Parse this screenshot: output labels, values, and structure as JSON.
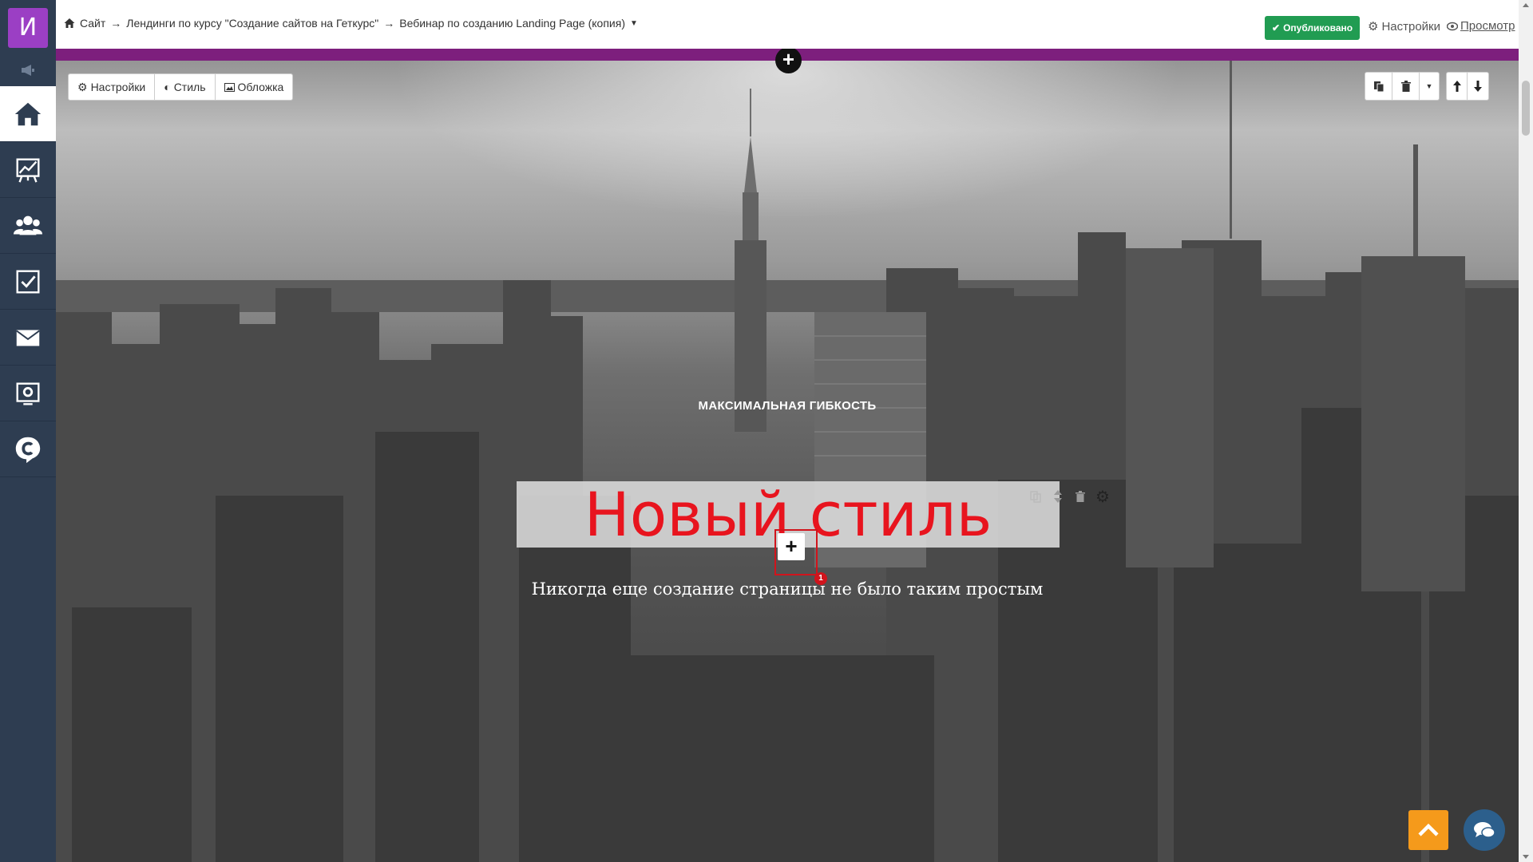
{
  "sidebar": {
    "logo_letter": "И",
    "items": [
      {
        "icon": "home-icon",
        "active": true
      },
      {
        "icon": "chart-board-icon",
        "active": false
      },
      {
        "icon": "users-icon",
        "active": false
      },
      {
        "icon": "checkbox-icon",
        "active": false
      },
      {
        "icon": "envelope-icon",
        "active": false
      },
      {
        "icon": "cog-monitor-icon",
        "active": false
      },
      {
        "icon": "chat-c-icon",
        "active": false
      }
    ]
  },
  "breadcrumb": {
    "site": "Сайт",
    "section": "Лендинги по курсу \"Создание сайтов на Геткурс\"",
    "page": "Вебинар по созданию Landing Page (копия)",
    "separator": "→"
  },
  "header": {
    "published_label": "Опубликовано",
    "settings_label": "Настройки",
    "preview_label": "Просмотр"
  },
  "block_toolbar": {
    "settings_label": "Настройки",
    "style_label": "Стиль",
    "cover_label": "Обложка"
  },
  "hero": {
    "eyebrow": "МАКСИМАЛЬНАЯ ГИБКОСТЬ",
    "title": "Новый стиль",
    "subtitle": "Никогда еще создание страницы не было таким простым",
    "badge_count": "1"
  },
  "colors": {
    "sidebar_bg": "#2e3d51",
    "logo_bg": "#9b3fc4",
    "published_green": "#219c52",
    "accent_purple": "#7d1f7d",
    "title_red": "#e8141e",
    "scroll_top_orange": "#f59a1b"
  }
}
